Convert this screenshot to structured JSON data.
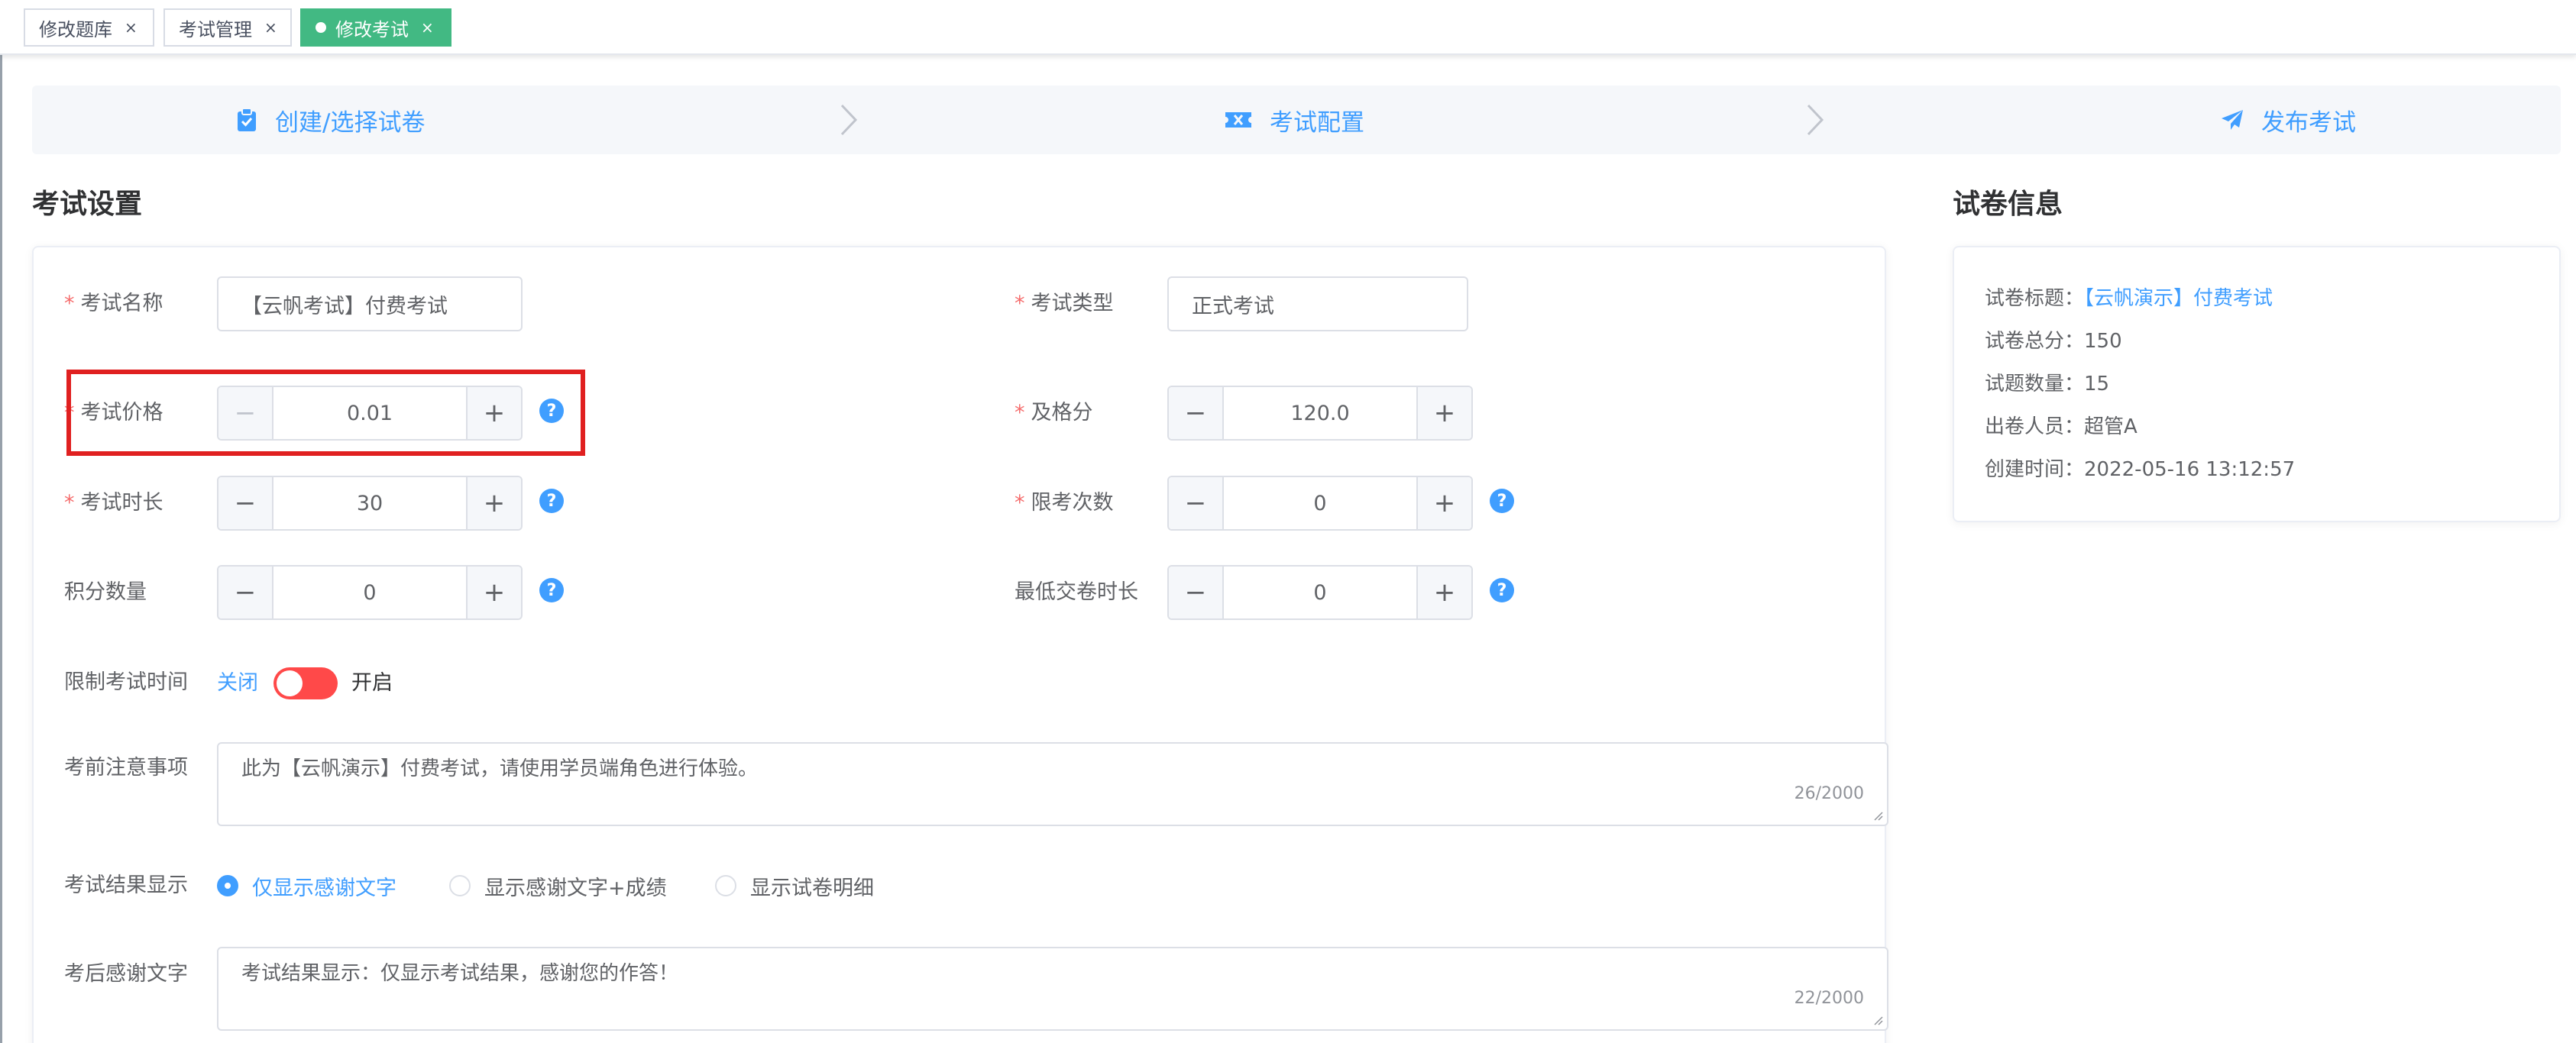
{
  "tabs": [
    {
      "label": "修改题库",
      "close": "×",
      "active": false
    },
    {
      "label": "考试管理",
      "close": "×",
      "active": false
    },
    {
      "label": "修改考试",
      "close": "×",
      "active": true
    }
  ],
  "steps": [
    {
      "label": "创建/选择试卷",
      "icon": "clipboard-check-icon"
    },
    {
      "label": "考试配置",
      "icon": "ticket-icon"
    },
    {
      "label": "发布考试",
      "icon": "paper-plane-icon"
    }
  ],
  "colors": {
    "primary": "#409eff",
    "required": "#f56c6c",
    "tab_active": "#42b983",
    "switch_on": "#ff4949",
    "highlight": "#e02020"
  },
  "settings": {
    "title": "考试设置",
    "required_mark": "*",
    "help_icon": "?",
    "minus": "−",
    "plus": "+",
    "exam_name": {
      "label": "考试名称",
      "value": "【云帆考试】付费考试"
    },
    "exam_type": {
      "label": "考试类型",
      "value": "正式考试"
    },
    "exam_price": {
      "label": "考试价格",
      "value": "0.01"
    },
    "pass_score": {
      "label": "及格分",
      "value": "120.0"
    },
    "duration": {
      "label": "考试时长",
      "value": "30"
    },
    "attempt_limit": {
      "label": "限考次数",
      "value": "0"
    },
    "points": {
      "label": "积分数量",
      "value": "0"
    },
    "min_submit_time": {
      "label": "最低交卷时长",
      "value": "0"
    },
    "time_limit": {
      "label": "限制考试时间",
      "off_text": "关闭",
      "on_text": "开启",
      "enabled": false
    },
    "notice": {
      "label": "考前注意事项",
      "value": "此为【云帆演示】付费考试，请使用学员端角色进行体验。",
      "count": "26/2000"
    },
    "result_display": {
      "label": "考试结果显示",
      "options": [
        "仅显示感谢文字",
        "显示感谢文字+成绩",
        "显示试卷明细"
      ],
      "selected": 0
    },
    "thanks_text": {
      "label": "考后感谢文字",
      "value": "考试结果显示：仅显示考试结果，感谢您的作答！",
      "count": "22/2000"
    }
  },
  "paper_info": {
    "title": "试卷信息",
    "rows": [
      {
        "label": "试卷标题：",
        "value": "【云帆演示】付费考试"
      },
      {
        "label": "试卷总分：",
        "value": "150"
      },
      {
        "label": "试题数量：",
        "value": "15"
      },
      {
        "label": "出卷人员：",
        "value": "超管A"
      },
      {
        "label": "创建时间：",
        "value": "2022-05-16 13:12:57"
      }
    ]
  }
}
